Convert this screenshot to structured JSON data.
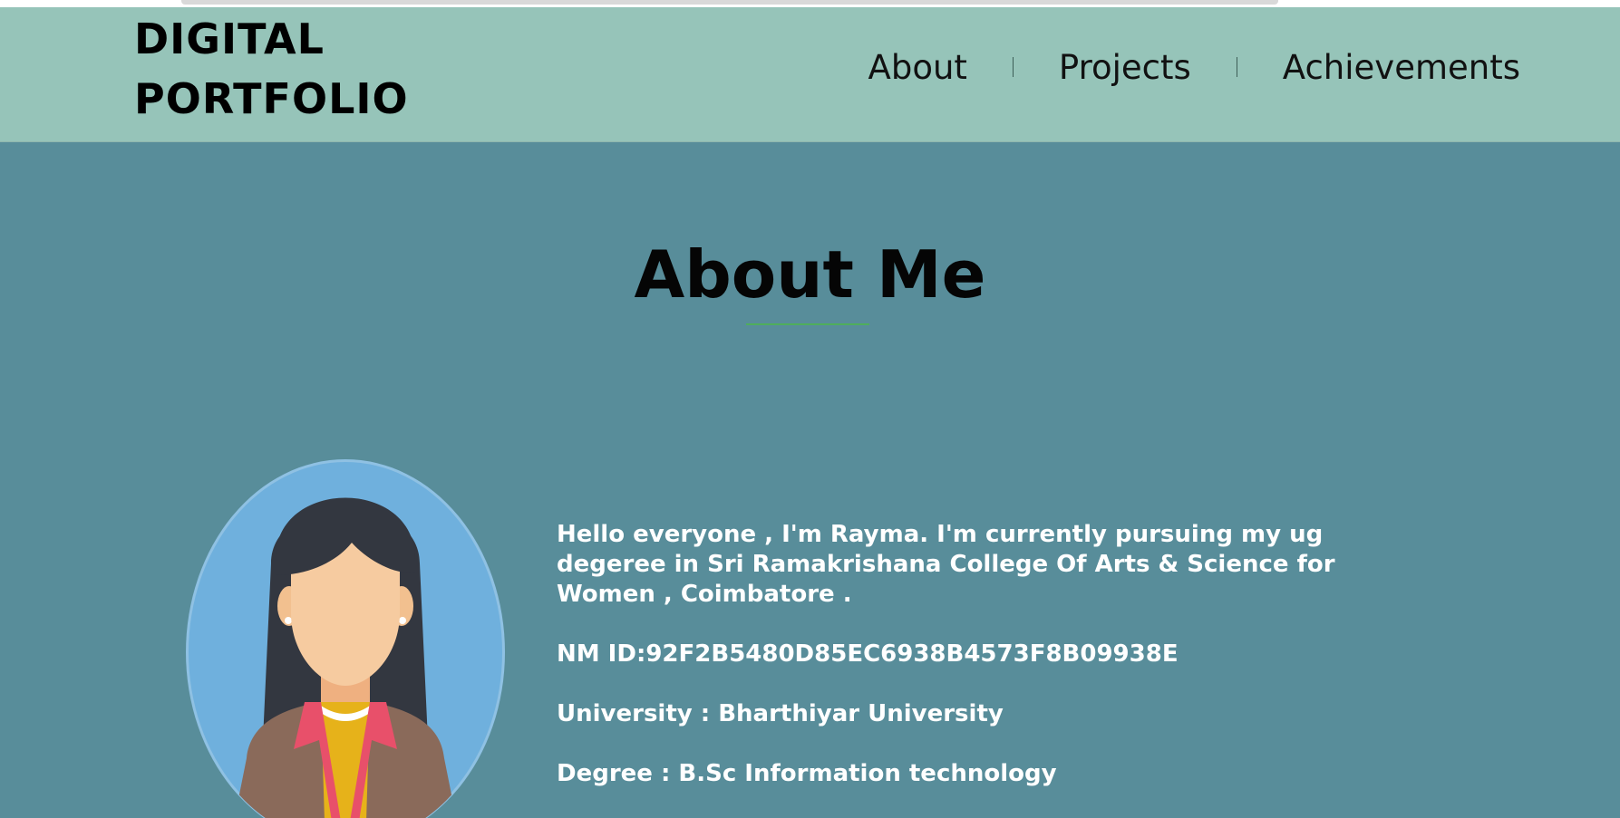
{
  "header": {
    "logo_line1": "DIGITAL",
    "logo_line2": "PORTFOLIO",
    "nav": [
      {
        "label": "About"
      },
      {
        "label": "Projects"
      },
      {
        "label": "Achievements"
      }
    ]
  },
  "about": {
    "title": "About Me",
    "intro": "Hello everyone , I'm Rayma. I'm currently pursuing my ug degeree in Sri Ramakrishana College Of Arts & Science for Women , Coimbatore .",
    "nm_id": "NM ID:92F2B5480D85EC6938B4573F8B09938E",
    "university": "University : Bharthiyar University",
    "degree": "Degree : B.Sc Information technology"
  },
  "icons": {
    "avatar": "female-avatar-icon"
  },
  "colors": {
    "header_bg": "#96c4b9",
    "page_bg": "#588d9a",
    "accent_underline": "#4fae5c",
    "text_light": "#ffffff",
    "text_dark": "#000000"
  }
}
